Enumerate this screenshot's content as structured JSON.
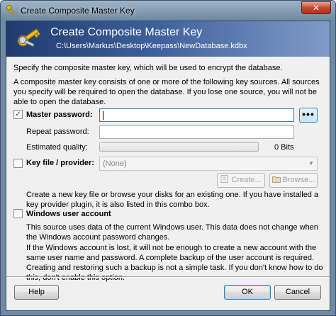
{
  "window": {
    "title": "Create Composite Master Key",
    "close_glyph": "✕"
  },
  "banner": {
    "title": "Create Composite Master Key",
    "path": "C:\\Users\\Markus\\Desktop\\Keepass\\NewDatabase.kdbx"
  },
  "intro": {
    "line1": "Specify the composite master key, which will be used to encrypt the database.",
    "line2": "A composite master key consists of one or more of the following key sources. All sources you specify will be required to open the database.  If you lose one source, you will not be able to open the database."
  },
  "master_password": {
    "checked": true,
    "check_glyph": "✓",
    "label": "Master password:",
    "value": "",
    "toggle_label": "•••",
    "repeat_label": "Repeat password:",
    "repeat_value": "",
    "quality_label": "Estimated quality:",
    "quality_fraction": 0,
    "quality_value": "0 Bits"
  },
  "key_file": {
    "checked": false,
    "label": "Key file / provider:",
    "selected": "(None)",
    "create_label": "Create...",
    "browse_label": "Browse...",
    "help": "Create a new key file or browse your disks for an existing one. If you have installed a key provider plugin, it is also listed in this combo box."
  },
  "windows_account": {
    "checked": false,
    "label": "Windows user account",
    "help1": "This source uses data of the current Windows user. This data does not change when the Windows account password changes.",
    "help2": "If the Windows account is lost, it will not be enough to create a new account with the same user name and password. A complete backup of the user account is required. Creating and restoring such a backup is not a simple task. If you don't know how to do this, don't enable this option."
  },
  "footer": {
    "help_label": "Help",
    "ok_label": "OK",
    "cancel_label": "Cancel"
  },
  "colors": {
    "banner_dark": "#1f3b6e",
    "banner_light": "#7f9bc8",
    "dialog_bg": "#f0f0f0",
    "focus_border": "#3d7bad"
  },
  "icons": {
    "title": "key-icon",
    "banner": "keys-icon",
    "create": "new-file-icon",
    "browse": "folder-icon"
  }
}
